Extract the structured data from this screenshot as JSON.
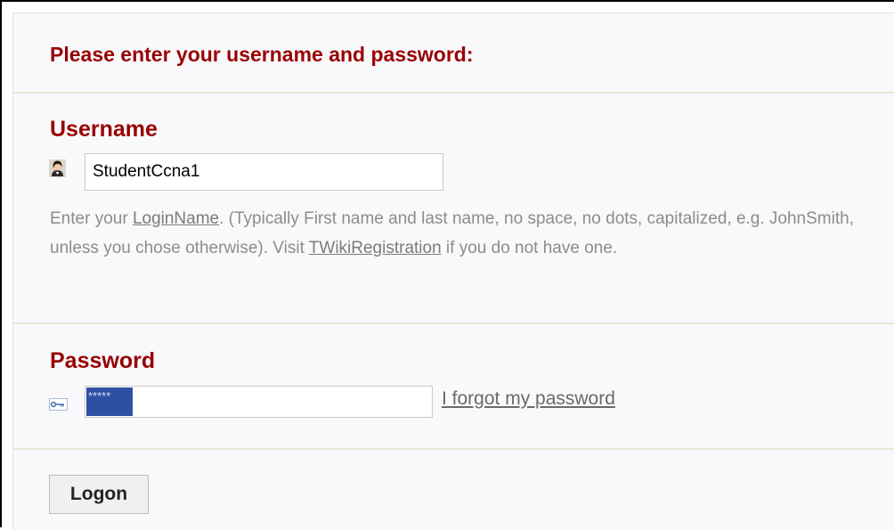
{
  "form": {
    "title": "Please enter your username and password:",
    "username": {
      "label": "Username",
      "icon": "user-icon",
      "value": "StudentCcna1",
      "hint_before": "Enter your ",
      "hint_link1": "LoginName",
      "hint_middle": ". (Typically First name and last name, no space, no dots, capitalized, e.g. JohnSmith, unless you chose otherwise). Visit ",
      "hint_link2": "TWikiRegistration",
      "hint_after": " if you do not have one."
    },
    "password": {
      "label": "Password",
      "icon": "key-icon",
      "value": "*****",
      "forgot_link": "I forgot my password"
    },
    "submit_label": "Logon"
  },
  "colors": {
    "heading": "#990000",
    "hint_text": "#8c8c8c",
    "panel_background": "#f9f9fc",
    "selection": "#2f4fa5"
  }
}
